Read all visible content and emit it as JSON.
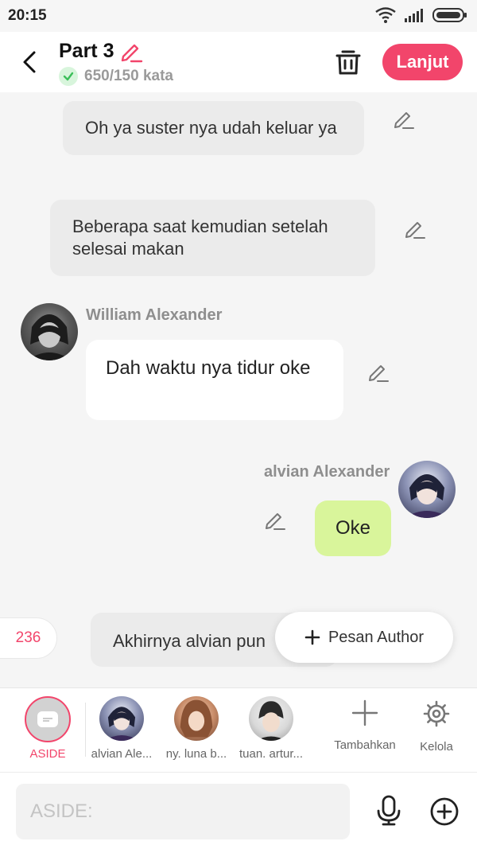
{
  "status": {
    "time": "20:15"
  },
  "header": {
    "title": "Part 3",
    "word_count": "650/150 kata",
    "next_label": "Lanjut"
  },
  "messages": {
    "narr1": "Oh ya suster nya udah keluar ya",
    "narr2": "Beberapa saat kemudian setelah selesai makan",
    "william": {
      "name": "William Alexander",
      "text": "Dah waktu nya tidur oke"
    },
    "alvian": {
      "name": "alvian Alexander",
      "text": "Oke"
    },
    "narr3": "Akhirnya alvian pun"
  },
  "badge": {
    "count": "236"
  },
  "author_button": {
    "label": "Pesan Author"
  },
  "characters": [
    {
      "label": "ASIDE"
    },
    {
      "label": "alvian Ale..."
    },
    {
      "label": "ny. luna b..."
    },
    {
      "label": "tuan. artur..."
    }
  ],
  "tools": {
    "add_label": "Tambahkan",
    "manage_label": "Kelola"
  },
  "input": {
    "placeholder": "ASIDE:"
  },
  "colors": {
    "accent": "#f2456b",
    "own_bubble": "#d9f59b",
    "narration_bubble": "#ebebeb"
  }
}
